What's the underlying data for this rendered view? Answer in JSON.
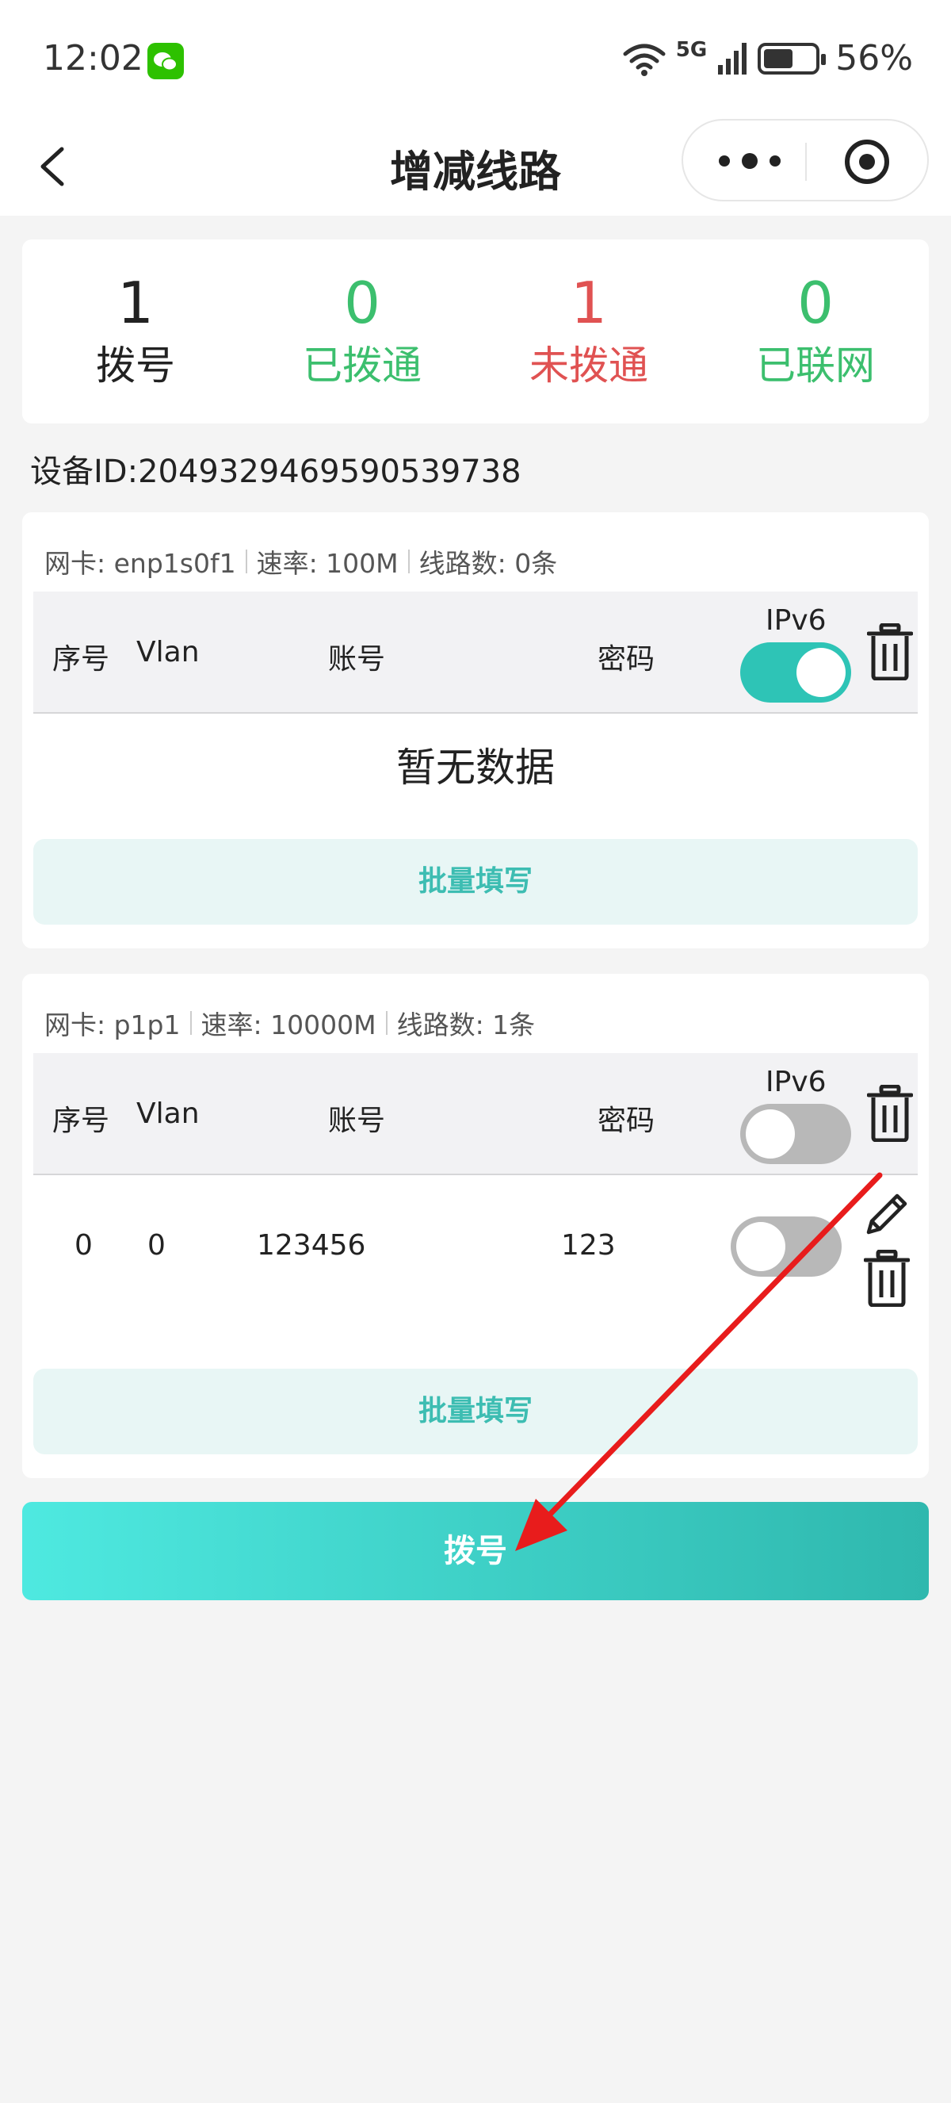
{
  "status_bar": {
    "time": "12:02",
    "network": "5G",
    "battery": "56%"
  },
  "nav": {
    "title": "增减线路"
  },
  "stats": [
    {
      "value": "1",
      "label": "拨号",
      "color": "#222222"
    },
    {
      "value": "0",
      "label": "已拨通",
      "color": "#3cbf6e"
    },
    {
      "value": "1",
      "label": "未拨通",
      "color": "#e05252"
    },
    {
      "value": "0",
      "label": "已联网",
      "color": "#3cbf6e"
    }
  ],
  "device_id": "设备ID:2049329469590539738",
  "table_headers": {
    "seq": "序号",
    "vlan": "Vlan",
    "account": "账号",
    "password": "密码",
    "ipv6": "IPv6"
  },
  "nics": [
    {
      "nic": "网卡: enp1s0f1",
      "rate": "速率: 100M",
      "lines": "线路数: 0条",
      "ipv6_enabled": true,
      "empty_text": "暂无数据",
      "rows": [],
      "bulk_label": "批量填写"
    },
    {
      "nic": "网卡: p1p1",
      "rate": "速率: 10000M",
      "lines": "线路数: 1条",
      "ipv6_enabled": false,
      "rows": [
        {
          "seq": "0",
          "vlan": "0",
          "account": "123456",
          "password": "123",
          "ipv6": false
        }
      ],
      "bulk_label": "批量填写"
    }
  ],
  "dial_button": "拨号",
  "colors": {
    "accent": "#2ec4b6",
    "annotation_arrow": "#e81c1c"
  }
}
